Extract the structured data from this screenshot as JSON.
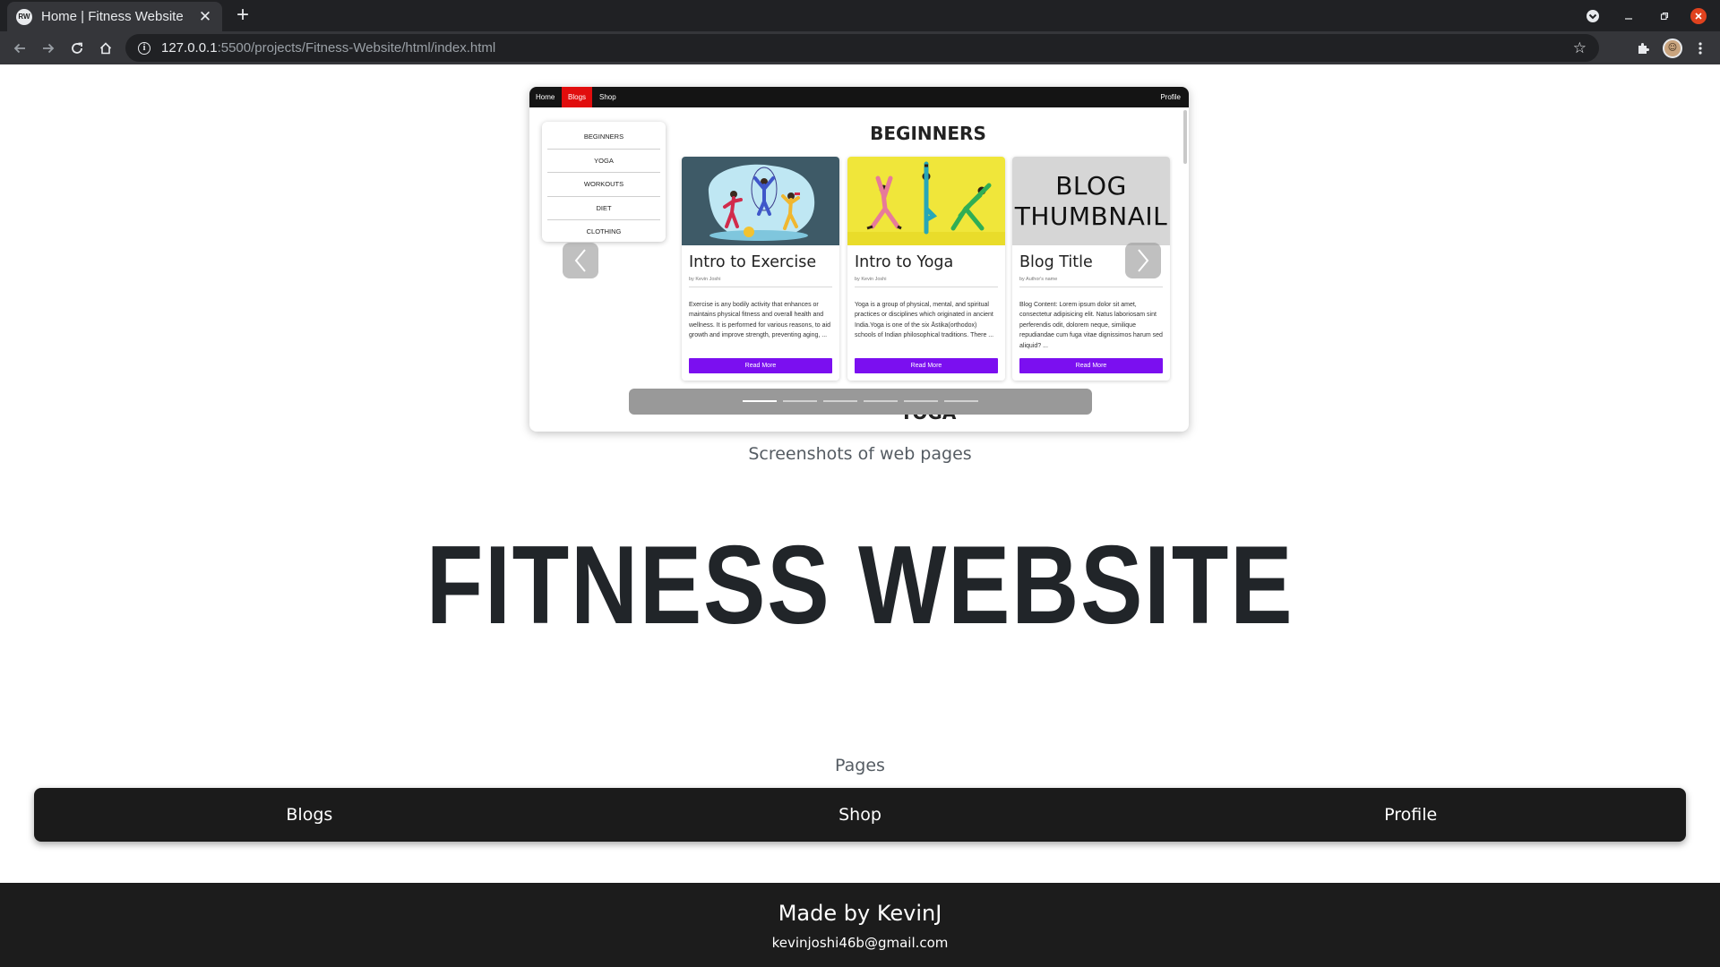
{
  "browser": {
    "tab_title": "Home | Fitness Website",
    "favicon_text": "RW",
    "tab_close": "✕",
    "new_tab": "+",
    "url_host": "127.0.0.1",
    "url_path": ":5500/projects/Fitness-Website/html/index.html"
  },
  "screenshot": {
    "nav": {
      "home": "Home",
      "blogs": "Blogs",
      "shop": "Shop",
      "profile": "Profile"
    },
    "categories": [
      "BEGINNERS",
      "YOGA",
      "WORKOUTS",
      "DIET",
      "CLOTHING"
    ],
    "section_title": "BEGINNERS",
    "next_section_title": "YOGA",
    "cards": [
      {
        "title": "Intro to Exercise",
        "author": "by Kevin Joshi",
        "text": "Exercise is any bodily activity that enhances or maintains physical fitness and overall health and wellness. It is performed for various reasons, to aid growth and improve strength, preventing aging, ...",
        "button": "Read More"
      },
      {
        "title": "Intro to Yoga",
        "author": "by Kevin Joshi",
        "text": "Yoga is a group of physical, mental, and spiritual practices or disciplines which originated in ancient India.Yoga is one of the six Āstika(orthodox) schools of Indian philosophical traditions. There ...",
        "button": "Read More"
      },
      {
        "title": "Blog Title",
        "author": "by Author's name",
        "text": "Blog Content: Lorem ipsum dolor sit amet, consectetur adipisicing elit. Natus laboriosam sint perferendis odit, dolorem neque, similique repudiandae cum fuga vitae dignissimos harum sed aliquid? ...",
        "button": "Read More",
        "thumb_line1": "BLOG",
        "thumb_line2": "THUMBNAIL"
      }
    ],
    "carousel_slides": 6,
    "carousel_active": 0
  },
  "caption_screenshots": "Screenshots of web pages",
  "main_title": "FITNESS WEBSITE",
  "pages_label": "Pages",
  "pages_links": [
    "Blogs",
    "Shop",
    "Profile"
  ],
  "footer": {
    "made_by": "Made by KevinJ",
    "email": "kevinjoshi46b@gmail.com"
  },
  "colors": {
    "accent_purple": "#7b0ff0",
    "active_nav_red": "#e10d0d",
    "dark_bar": "#1b1b1b"
  }
}
